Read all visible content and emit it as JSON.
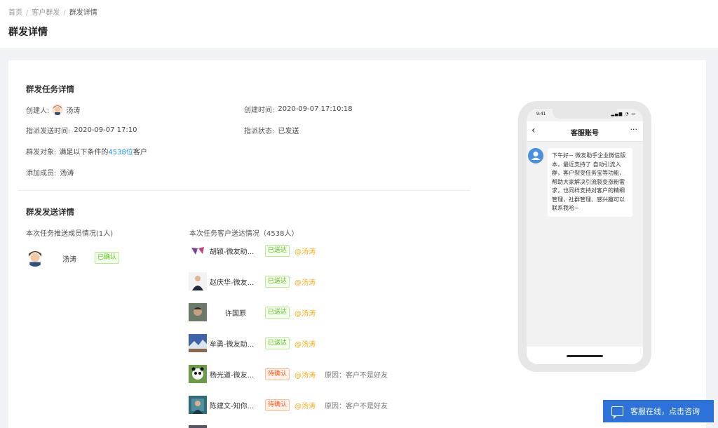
{
  "breadcrumb": {
    "items": [
      "首页",
      "客户群发"
    ],
    "current": "群发详情",
    "separator": "/"
  },
  "page_title": "群发详情",
  "task": {
    "section_title": "群发任务详情",
    "creator_label": "创建人:",
    "creator_name": "汤涛",
    "created_time_label": "创建时间:",
    "created_time": "2020-09-07 17:10:18",
    "send_time_label": "指派发送时间:",
    "send_time": "2020-09-07 17:10",
    "status_label": "指派状态:",
    "status": "已发送",
    "target_label": "群发对象:",
    "target_prefix": "满足以下条件的",
    "target_count": "4538位",
    "target_suffix": "客户",
    "member_label": "添加成员:",
    "member_name": "汤涛"
  },
  "send": {
    "section_title": "群发发送详情",
    "members_title": "本次任务推送成员情况(1人)",
    "members": [
      {
        "name": "汤涛",
        "status": "已确认"
      }
    ],
    "customers_title": "本次任务客户送达情况（4538人）",
    "customers": [
      {
        "name": "胡颖-微友助...",
        "status": "已送达",
        "status_type": "ok",
        "owner": "@汤涛",
        "reason": ""
      },
      {
        "name": "赵庆华-微友...",
        "status": "已送达",
        "status_type": "ok",
        "owner": "@汤涛",
        "reason": ""
      },
      {
        "name": "许国原",
        "status": "已送达",
        "status_type": "ok",
        "owner": "@汤涛",
        "reason": ""
      },
      {
        "name": "牟勇-微友助...",
        "status": "已送达",
        "status_type": "ok",
        "owner": "@汤涛",
        "reason": ""
      },
      {
        "name": "杨光道-微友...",
        "status": "待确认",
        "status_type": "wait",
        "owner": "@汤涛",
        "reason": "原因：客户不是好友"
      },
      {
        "name": "陈建文-知你...",
        "status": "待确认",
        "status_type": "wait",
        "owner": "@汤涛",
        "reason": "原因：客户不是好友"
      }
    ]
  },
  "phone": {
    "time": "9:41",
    "nav_title": "客服账号",
    "back_icon": "‹",
    "more_icon": "···",
    "message": "下午好~ 微友助手企业微信版本，最近支持了 自动引流入群，客户裂变任务宝等功能，帮助大家解决引流裂变涨粉需求，也同样支持对客户的精细管理，社群管理、感兴趣可以联系我哈~"
  },
  "support_button": {
    "label": "客服在线，点击咨询"
  },
  "colors": {
    "accent": "#1890ff",
    "success": "#52c41a",
    "warning": "#fa541c",
    "owner": "#faad14",
    "support": "#2d72d9"
  }
}
